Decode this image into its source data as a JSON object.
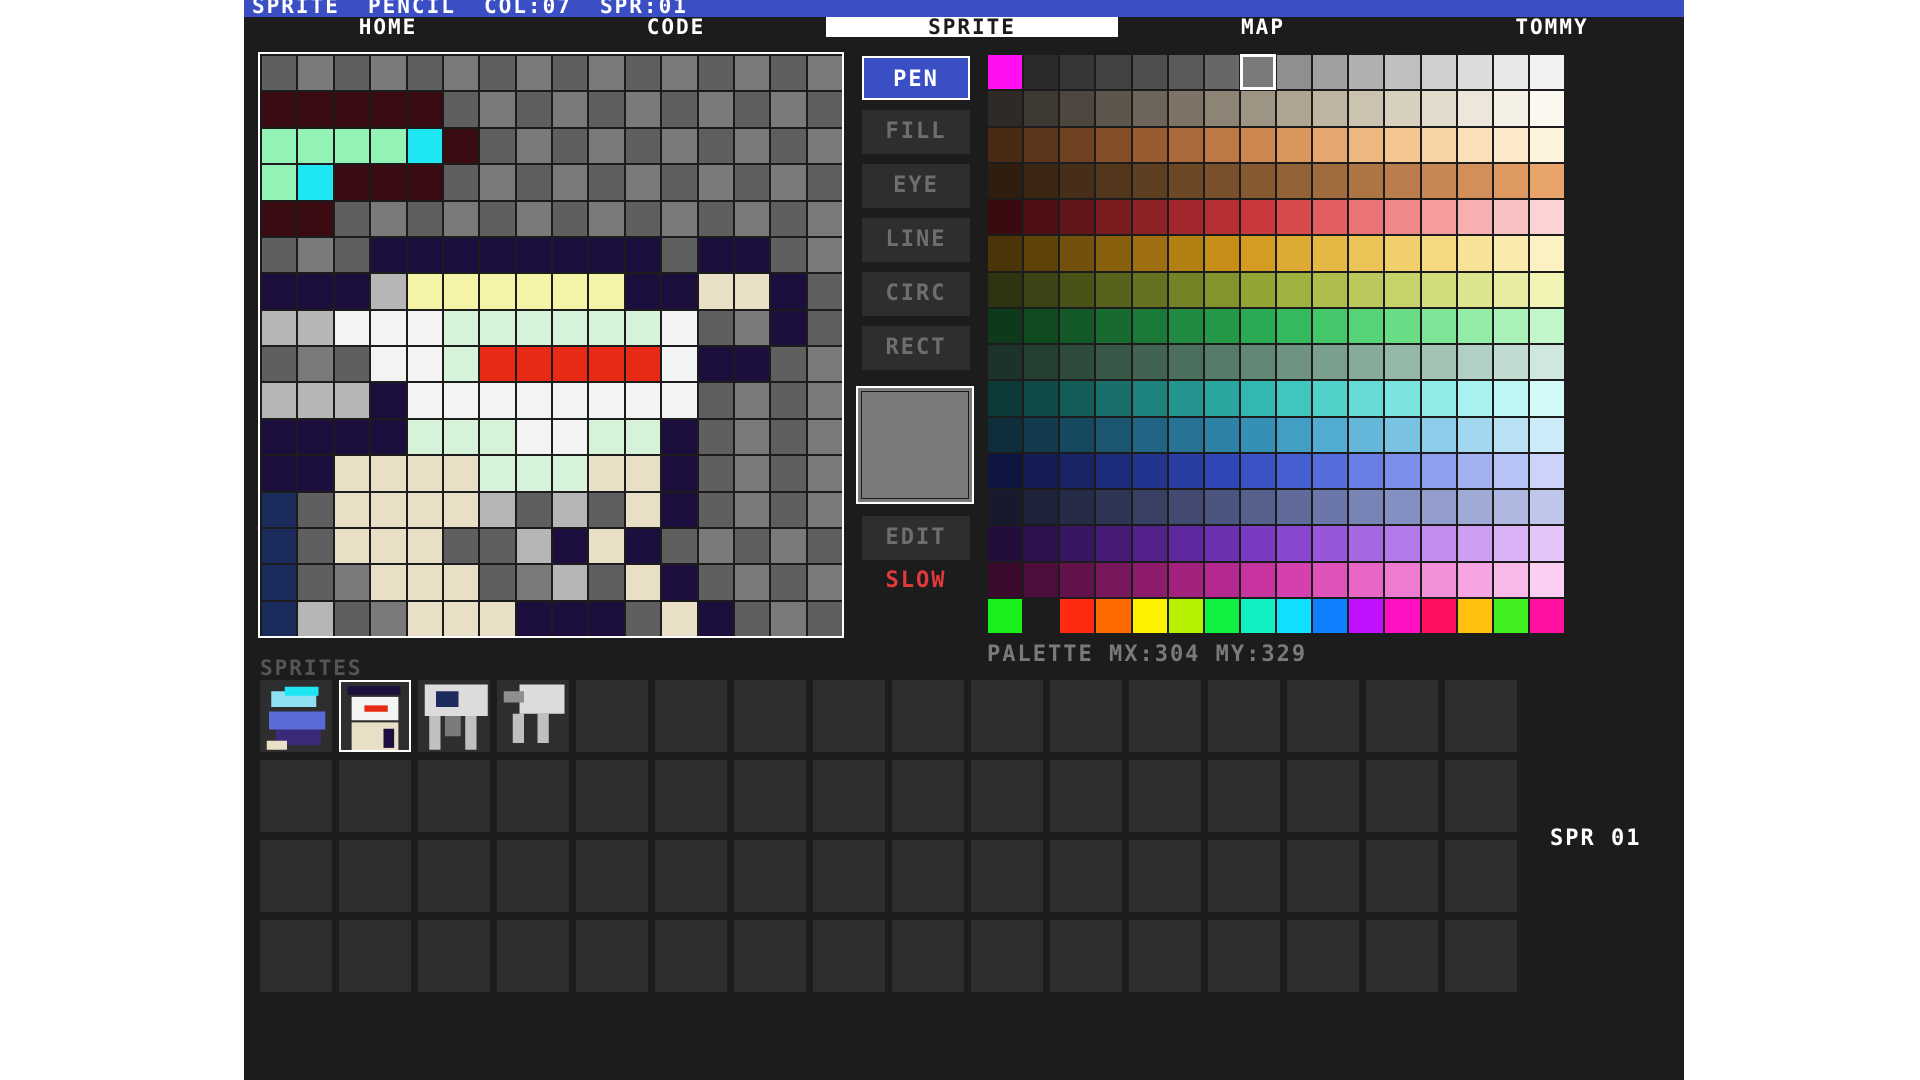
{
  "status_bar": {
    "mode": "SPRITE",
    "tool": "PENCIL",
    "color": "COL:07",
    "sprite": "SPR:01"
  },
  "tabs": [
    {
      "label": "HOME",
      "active": false
    },
    {
      "label": "CODE",
      "active": false
    },
    {
      "label": "SPRITE",
      "active": true
    },
    {
      "label": "MAP",
      "active": false
    },
    {
      "label": "TOMMY",
      "active": false
    }
  ],
  "tools": [
    {
      "label": "PEN",
      "active": true
    },
    {
      "label": "FILL",
      "active": false
    },
    {
      "label": "EYE",
      "active": false
    },
    {
      "label": "LINE",
      "active": false
    },
    {
      "label": "CIRC",
      "active": false
    },
    {
      "label": "RECT",
      "active": false
    }
  ],
  "edit_label": "EDIT",
  "slow_label": "SLOW",
  "current_color": "#7a7a7a",
  "palette_label": "PALETTE MX:304 MY:329",
  "sprites_label": "SPRITES",
  "sprite_indicator": "SPR 01",
  "sprite_pixels": [
    "gGgGgGgGgGgGgGgG",
    "MMMMMgGgGgGgGgGg",
    "TTTTCMgGgGgGgGgG",
    "TCMMMgGgGgGgGgGg",
    "MMgGgGgGgGgGgGgG",
    "gGgNNNNNNNNgNNgG",
    "NNNLYYYYYYNNBBNg",
    "LLWWWPPPPPPWgGNg",
    "gGgWWPRRRRRWNNgG",
    "LLLNWWWWWWWWgGgG",
    "NNNNPPPWWPPNgGgG",
    "NNBBBBPPPBBNgGgG",
    "DgBBBBLgLgBNgGgG",
    "DgBBBggLNBNgGgG",
    "DgGBBBgGLgBNgGgG",
    "DLgGBBBNNNgBNgGgG"
  ],
  "pixel_colors": {
    "g": "#5f5f5f",
    "G": "#7a7a7a",
    "M": "#3b0b12",
    "T": "#93f2b5",
    "C": "#1ee6f2",
    "N": "#1d0f3d",
    "L": "#b6b6b6",
    "Y": "#f4f3a8",
    "B": "#e9dfc6",
    "W": "#f3f3f3",
    "P": "#d6f2d8",
    "R": "#e62a14",
    "D": "#1b2c5c"
  },
  "palette_colors": [
    [
      "#ff10f0",
      "#2b2b2b",
      "#363636",
      "#424242",
      "#4e4e4e",
      "#5a5a5a",
      "#676767",
      "#7a7a7a",
      "#8f8f8f",
      "#a0a0a0",
      "#b0b0b0",
      "#c0c0c0",
      "#cfcfcf",
      "#dcdcdc",
      "#e8e8e8",
      "#f2f2f2"
    ],
    [
      "#2e2b27",
      "#3d3933",
      "#4d4740",
      "#5d564d",
      "#6d655a",
      "#7d7467",
      "#8d8475",
      "#9d9483",
      "#aea592",
      "#beb6a2",
      "#cbc3b0",
      "#d7d0bf",
      "#e2dccd",
      "#ece7da",
      "#f4f0e6",
      "#fbf8f0"
    ],
    [
      "#4a2a14",
      "#5c351a",
      "#704221",
      "#844f28",
      "#985c30",
      "#ab6a39",
      "#bd7843",
      "#cd874f",
      "#da975d",
      "#e5a76e",
      "#edb780",
      "#f3c692",
      "#f7d4a5",
      "#fae0b8",
      "#fdeacb",
      "#fef3dd"
    ],
    [
      "#2f1e10",
      "#3b2614",
      "#472e18",
      "#53371c",
      "#5f3f21",
      "#6c4826",
      "#79502b",
      "#865931",
      "#936237",
      "#a06b3d",
      "#ad7444",
      "#ba7d4b",
      "#c78653",
      "#d38f5a",
      "#de9961",
      "#e8a469"
    ],
    [
      "#3a0a0e",
      "#4e1014",
      "#63161a",
      "#791c20",
      "#8e2227",
      "#a3282d",
      "#b52f33",
      "#c9393c",
      "#d84a4c",
      "#e25e60",
      "#ea7375",
      "#f0888a",
      "#f49c9e",
      "#f7afb1",
      "#fac1c3",
      "#fcd2d4"
    ],
    [
      "#4a3408",
      "#5e420a",
      "#73510c",
      "#88600e",
      "#9d6f10",
      "#b27f12",
      "#c68e16",
      "#d49d22",
      "#ddab33",
      "#e5b845",
      "#ebc458",
      "#f0cf6c",
      "#f4d981",
      "#f7e297",
      "#faeaad",
      "#fcf1c3"
    ],
    [
      "#2f3410",
      "#3c4314",
      "#4a5218",
      "#58621c",
      "#667221",
      "#758226",
      "#84932c",
      "#93a334",
      "#a1b13f",
      "#aebd4c",
      "#bbc85b",
      "#c7d26b",
      "#d2dc7c",
      "#dde48e",
      "#e7eca1",
      "#f0f3b4"
    ],
    [
      "#0c3a1a",
      "#0f4a21",
      "#135a28",
      "#176a30",
      "#1b7a38",
      "#1f8a40",
      "#249a49",
      "#2aaa53",
      "#35b95e",
      "#44c66a",
      "#56d277",
      "#6adc86",
      "#7fe596",
      "#95eca7",
      "#abf2b8",
      "#c1f7ca"
    ],
    [
      "#1d3329",
      "#263f33",
      "#2f4b3d",
      "#385747",
      "#426352",
      "#4c6f5d",
      "#577b69",
      "#628775",
      "#6e9381",
      "#7a9f8d",
      "#87ab9a",
      "#95b7a7",
      "#a3c3b5",
      "#b2cfc3",
      "#c1dbd1",
      "#d0e7df"
    ],
    [
      "#0b3a38",
      "#0f4c49",
      "#145e5a",
      "#19706b",
      "#1e827d",
      "#23948e",
      "#2aa6a0",
      "#33b7b1",
      "#40c5bf",
      "#52d1cb",
      "#66dbd6",
      "#7be4df",
      "#91ebe7",
      "#a7f1ee",
      "#bdf6f4",
      "#d2faf9"
    ],
    [
      "#0e2e3c",
      "#123b4d",
      "#16495f",
      "#1b5771",
      "#206583",
      "#267395",
      "#2d82a6",
      "#3690b6",
      "#429ec4",
      "#52abd0",
      "#65b7da",
      "#79c2e2",
      "#8ecde9",
      "#a3d7ef",
      "#b8e1f4",
      "#cceaf8"
    ],
    [
      "#0e1540",
      "#131c53",
      "#182466",
      "#1d2c7a",
      "#22358e",
      "#283ea2",
      "#2f48b5",
      "#3953c5",
      "#4660d2",
      "#566edc",
      "#687ee4",
      "#7b8fea",
      "#8fa0ef",
      "#a3b1f3",
      "#b7c2f7",
      "#cbd3fa"
    ],
    [
      "#161a2c",
      "#1e2339",
      "#262c47",
      "#2f3655",
      "#384063",
      "#424a71",
      "#4c557f",
      "#56608d",
      "#616b9b",
      "#6c77a9",
      "#7883b6",
      "#8590c2",
      "#929dcd",
      "#a0aad7",
      "#afb8e0",
      "#bec6e9"
    ],
    [
      "#220d3b",
      "#2d114e",
      "#391662",
      "#451b76",
      "#52218a",
      "#5f289e",
      "#6d30b1",
      "#7b3ac2",
      "#8947cf",
      "#9856da",
      "#a667e2",
      "#b479e9",
      "#c18cee",
      "#cd9ff2",
      "#d9b2f6",
      "#e4c5f9"
    ],
    [
      "#3a0a2c",
      "#4e0e3b",
      "#63124b",
      "#78175b",
      "#8d1c6c",
      "#a2227d",
      "#b5298e",
      "#c7339f",
      "#d440ad",
      "#df52ba",
      "#e766c6",
      "#ed7bd0",
      "#f290da",
      "#f6a5e2",
      "#f9baea",
      "#fccef1"
    ],
    [
      "#19f019",
      "#1c1c1c",
      "#ff2a10",
      "#ff6a00",
      "#fff200",
      "#b6f200",
      "#10f040",
      "#10f0c0",
      "#10e0ff",
      "#1080ff",
      "#c010ff",
      "#ff10c0",
      "#ff1060",
      "#ffc010",
      "#40f020",
      "#ff10a0"
    ]
  ]
}
